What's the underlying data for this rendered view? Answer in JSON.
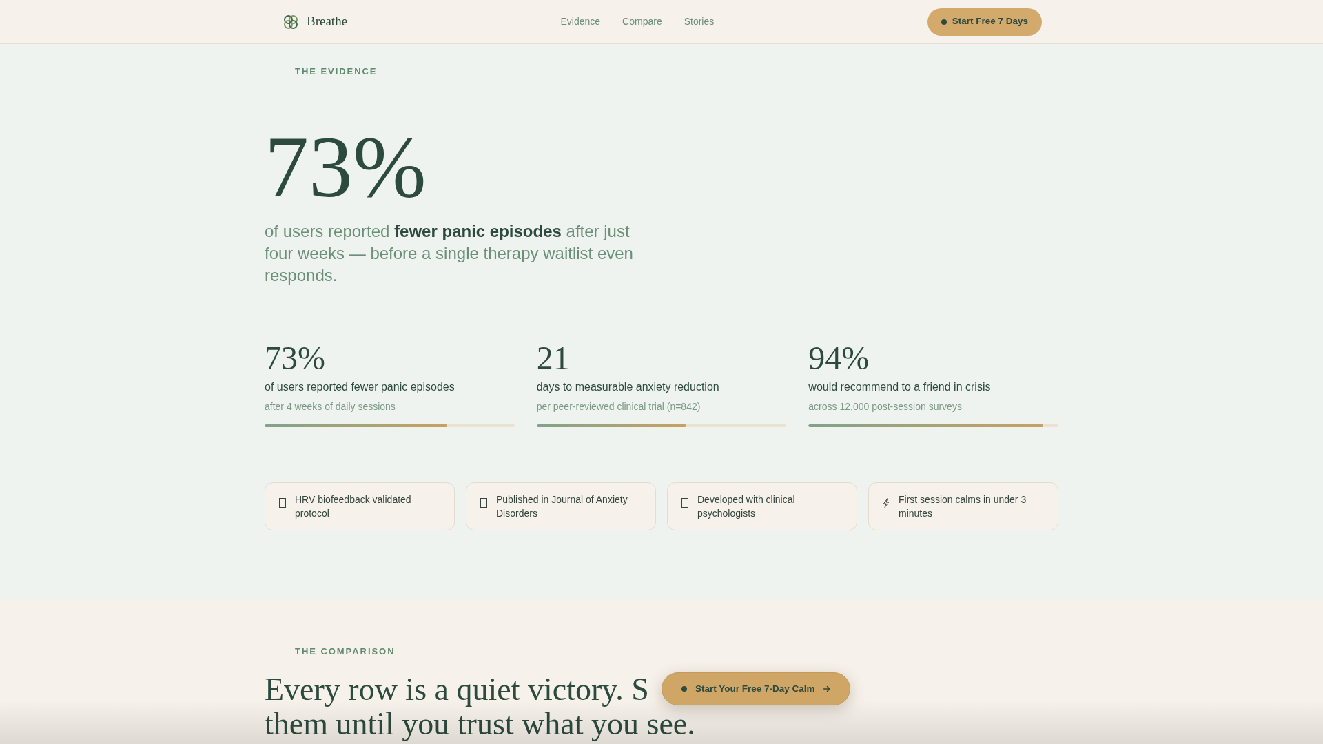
{
  "header": {
    "brand": "Breathe",
    "nav": [
      "Evidence",
      "Compare",
      "Stories"
    ],
    "cta": "Start Free 7 Days"
  },
  "evidence": {
    "eyebrow": "THE EVIDENCE",
    "headline": "73%",
    "lead": "of users reported **fewer panic episodes** after just four weeks — before a single therapy waitlist even responds.",
    "stats": [
      {
        "value": "73%",
        "label": "of users reported fewer panic episodes",
        "note": "after 4 weeks of daily sessions",
        "level": 0.73
      },
      {
        "value": "21",
        "label": "days to measurable anxiety reduction",
        "note": "per peer-reviewed clinical trial (n=842)",
        "level": 0.6
      },
      {
        "value": "94%",
        "label": "would recommend to a friend in crisis",
        "note": "across 12,000 post-session surveys",
        "level": 0.94
      }
    ],
    "features": [
      {
        "kind": "glyph-box",
        "text": "HRV biofeedback validated protocol"
      },
      {
        "kind": "glyph-box",
        "text": "Published in Journal of Anxiety Disorders"
      },
      {
        "kind": "glyph-box",
        "text": "Developed with clinical psychologists"
      },
      {
        "kind": "bolt",
        "text": "First session calms in under 3 minutes"
      }
    ]
  },
  "comparison": {
    "eyebrow": "THE COMPARISON",
    "heading_lines": [
      "Every row is a quiet victory. S",
      "them until you trust what you see."
    ]
  },
  "floating_cta": {
    "label": "Start Your Free 7-Day Calm"
  }
}
